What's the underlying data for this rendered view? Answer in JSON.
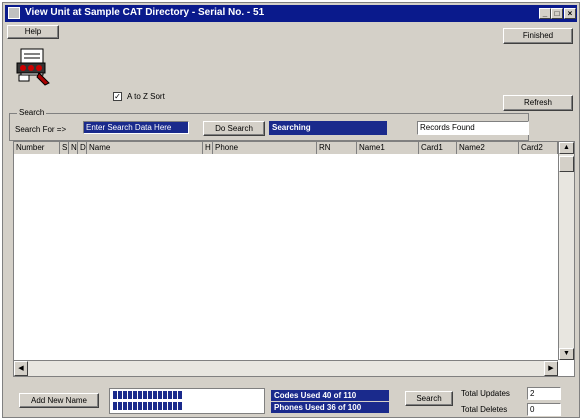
{
  "window": {
    "title": "View Unit at Sample CAT Directory - Serial No. - 51",
    "title_bg": "#0a1a8c",
    "controls": [
      "minimize-icon",
      "maximize-icon",
      "close-icon"
    ]
  },
  "toolbar": {
    "help_label": "Help",
    "finished_label": "Finished",
    "refresh_label": "Refresh"
  },
  "options": {
    "sort_label": "A to Z Sort",
    "sort_checked": true
  },
  "search": {
    "group_label": "Search",
    "prompt": "Search For =>",
    "input_value": "Enter Search Data Here",
    "button_label": "Do Search",
    "status": "Searching",
    "records_found_label": "Records Found"
  },
  "table": {
    "columns": [
      "Number",
      "S",
      "N",
      "D",
      "Name",
      "H",
      "Phone",
      "RN",
      "Name1",
      "Card1",
      "Name2",
      "Card2"
    ],
    "rows": []
  },
  "footer": {
    "add_button_label": "Add New Name",
    "search_button_label": "Search",
    "codes_used": "Codes   Used 40 of 110",
    "phones_used": "Phones Used 36 of 100",
    "total_updates_label": "Total Updates",
    "total_updates_value": "2",
    "total_deletes_label": "Total Deletes",
    "total_deletes_value": "0"
  },
  "colors": {
    "accent": "#1a2a8c",
    "face": "#d4d0c8"
  }
}
